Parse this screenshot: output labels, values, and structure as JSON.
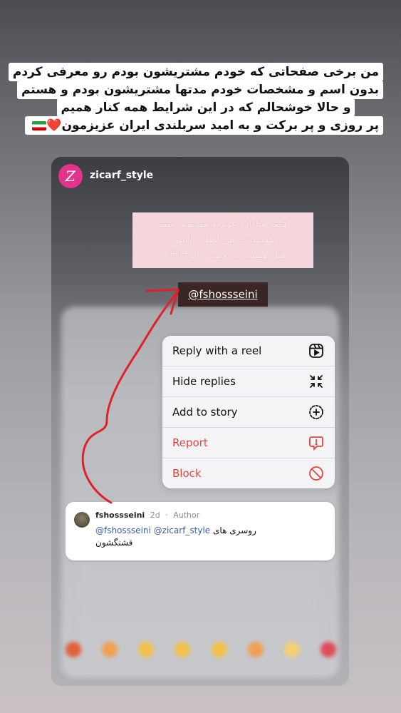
{
  "caption": {
    "lines": [
      "من برخی صفحاتی که خودم مشتریشون بودم رو معرفی کردم",
      "بدون اسم و مشخصات خودم مدتها مشتریشون بودم و هستم",
      "و حالا خوشحالم که در این شرایط همه کنار همیم",
      "پر روزی و پر برکت و به امید سربلندی ایران عزیزمون"
    ],
    "heart": "❤️",
    "flag_icon": "iran-flag-icon"
  },
  "story": {
    "username": "zicarf_style",
    "avatar_letter": "Z",
    "sticker_lines": [
      "فضه سادات عزیز و مهربونم شما",
      "همیشه به من لطف داشتی",
      "مثل همیشه بدرخشی بانو😍😍😍"
    ],
    "mention_tag": "@fshossseini"
  },
  "menu": {
    "items": [
      {
        "label": "Reply with a reel",
        "icon": "reel-icon",
        "danger": false
      },
      {
        "label": "Hide replies",
        "icon": "collapse-icon",
        "danger": false
      },
      {
        "label": "Add to story",
        "icon": "add-story-icon",
        "danger": false
      },
      {
        "label": "Report",
        "icon": "report-icon",
        "danger": true
      },
      {
        "label": "Block",
        "icon": "block-icon",
        "danger": true
      }
    ],
    "danger_color": "#e8453c"
  },
  "comment": {
    "username": "fshossseini",
    "age": "2d",
    "role": "Author",
    "mention1": "@fshossseini",
    "mention2": "@zicarf_style",
    "text": "روسری های",
    "text2": "قشنگشون"
  },
  "colors": {
    "mention": "#3b5fa8",
    "arrow": "#e0202a"
  }
}
